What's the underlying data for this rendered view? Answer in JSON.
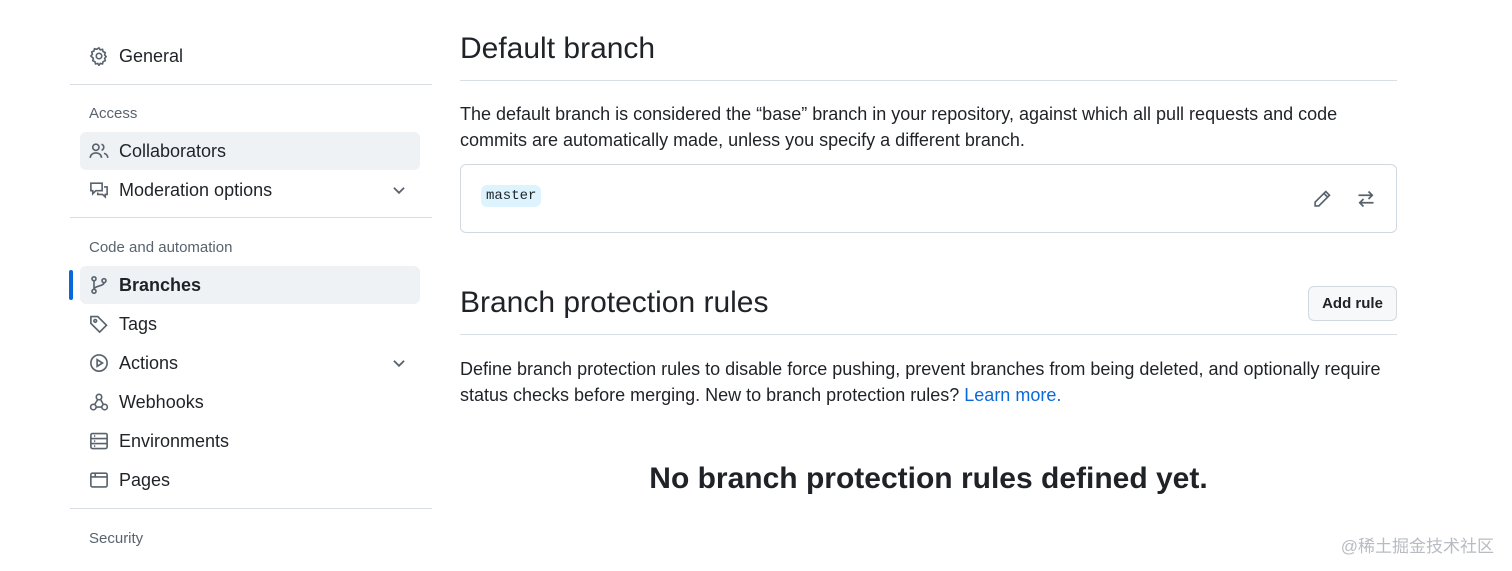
{
  "sidebar": {
    "general": "General",
    "access_label": "Access",
    "collaborators": "Collaborators",
    "moderation": "Moderation options",
    "code_label": "Code and automation",
    "branches": "Branches",
    "tags": "Tags",
    "actions": "Actions",
    "webhooks": "Webhooks",
    "environments": "Environments",
    "pages": "Pages",
    "security_label": "Security"
  },
  "main": {
    "default_branch_title": "Default branch",
    "default_branch_desc": "The default branch is considered the “base” branch in your repository, against which all pull requests and code commits are automatically made, unless you specify a different branch.",
    "branch_name": "master",
    "protection_title": "Branch protection rules",
    "add_rule": "Add rule",
    "protection_desc": "Define branch protection rules to disable force pushing, prevent branches from being deleted, and optionally require status checks before merging. New to branch protection rules?",
    "learn_more": "Learn more.",
    "empty_state": "No branch protection rules defined yet."
  },
  "watermark": "@稀土掘金技术社区",
  "colors": {
    "accent": "#0969da",
    "active_bg": "#eff2f5",
    "pill_bg": "#ddf4ff"
  }
}
